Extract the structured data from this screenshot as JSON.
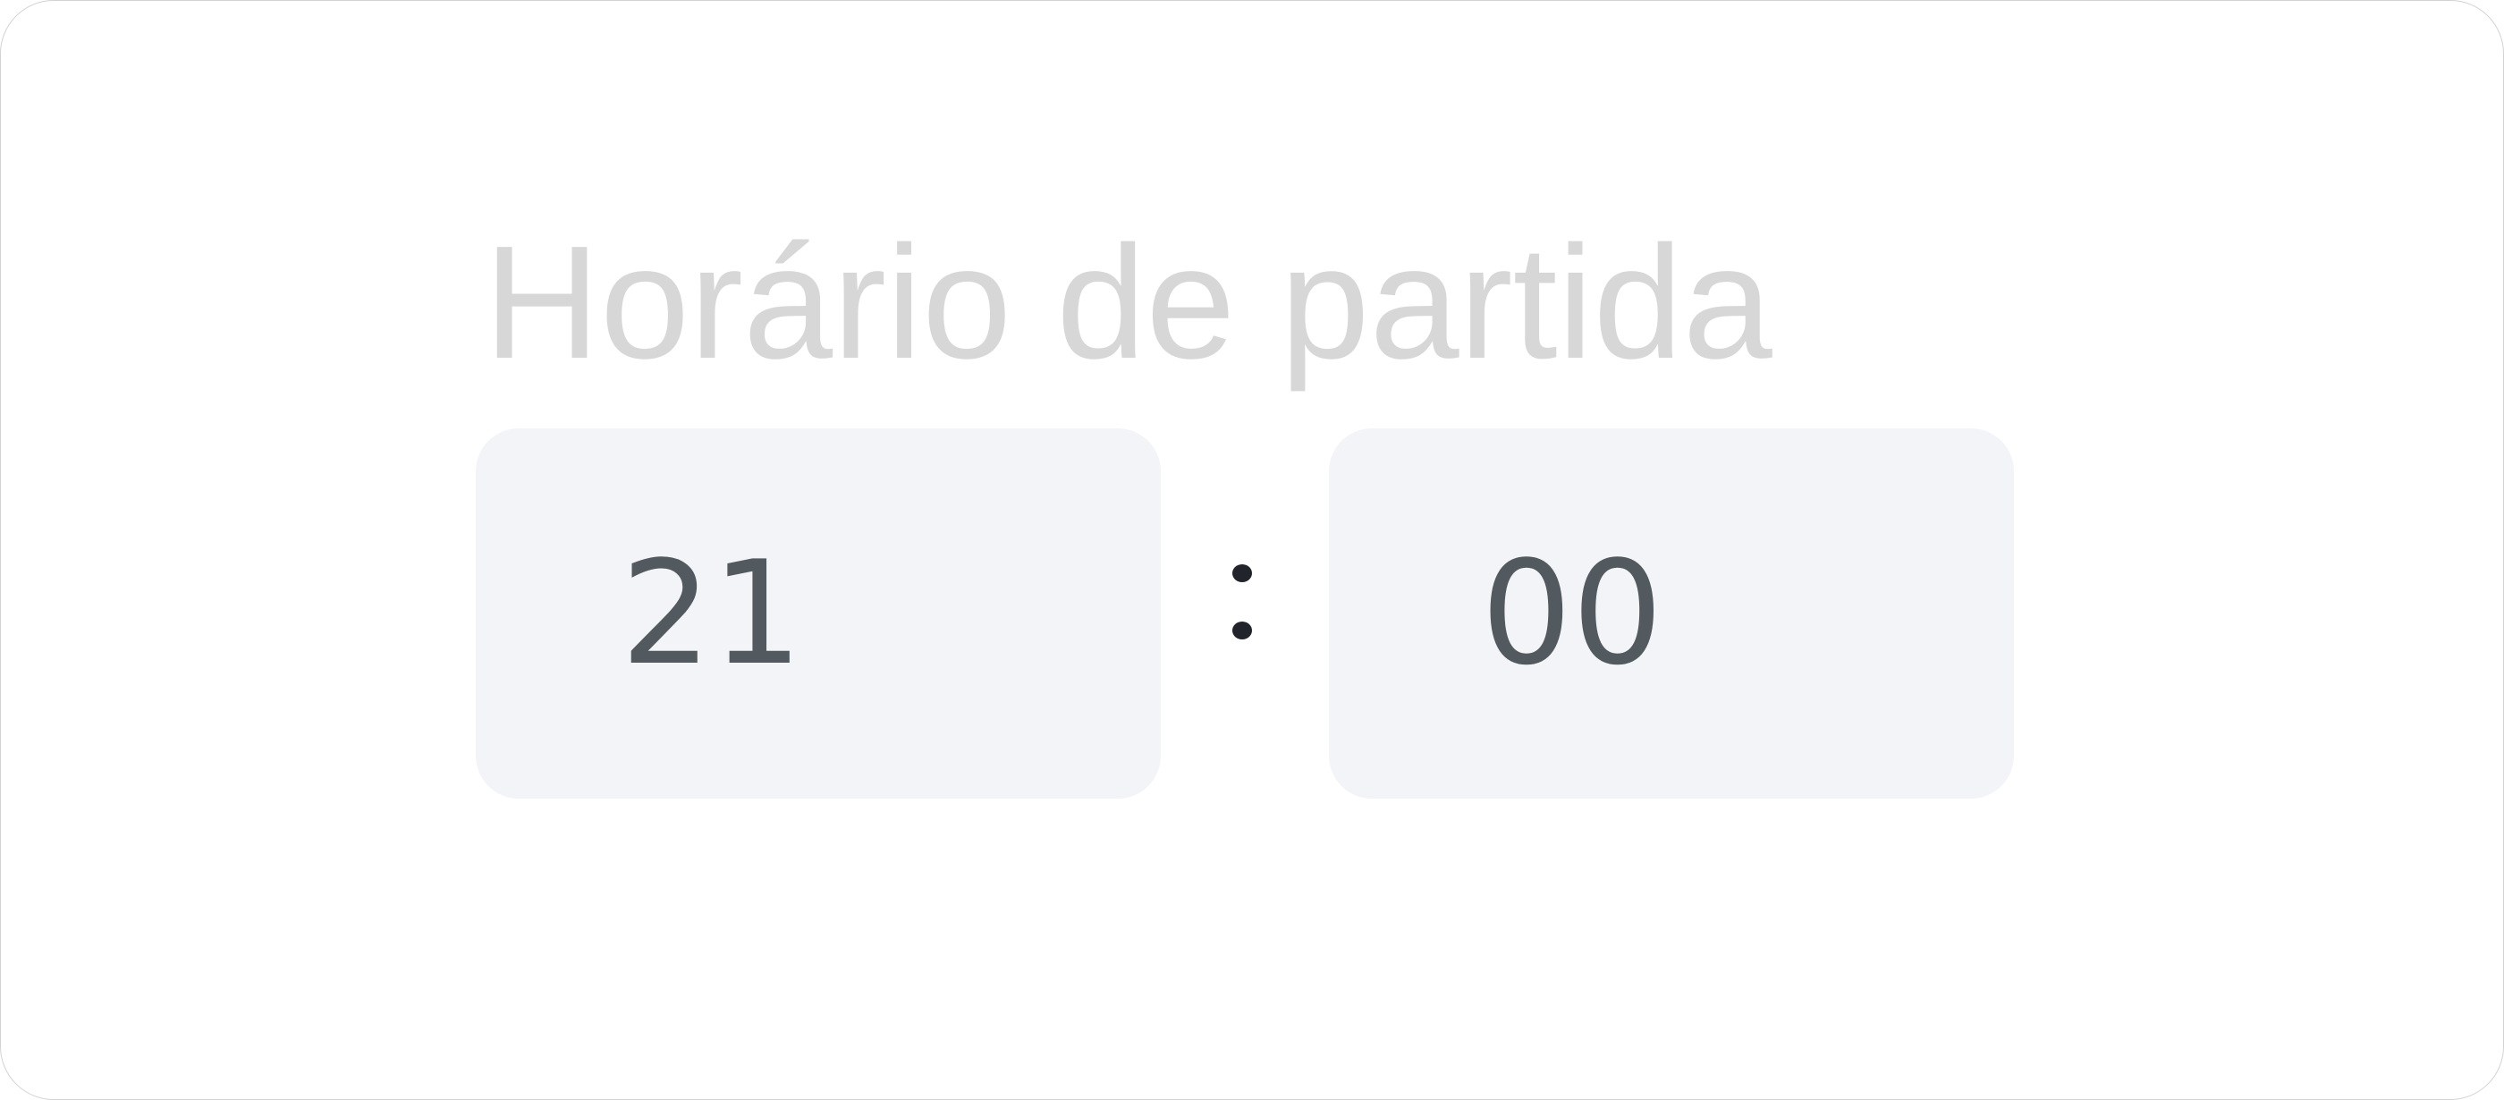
{
  "title": "Horário de partida",
  "time": {
    "hours": "21",
    "minutes": "00",
    "separator": ":"
  },
  "colors": {
    "title": "#d7d7d7",
    "field_background": "#f3f4f8",
    "digits": "#525a60",
    "separator": "#21252b",
    "card_border": "#d2d2d2"
  }
}
